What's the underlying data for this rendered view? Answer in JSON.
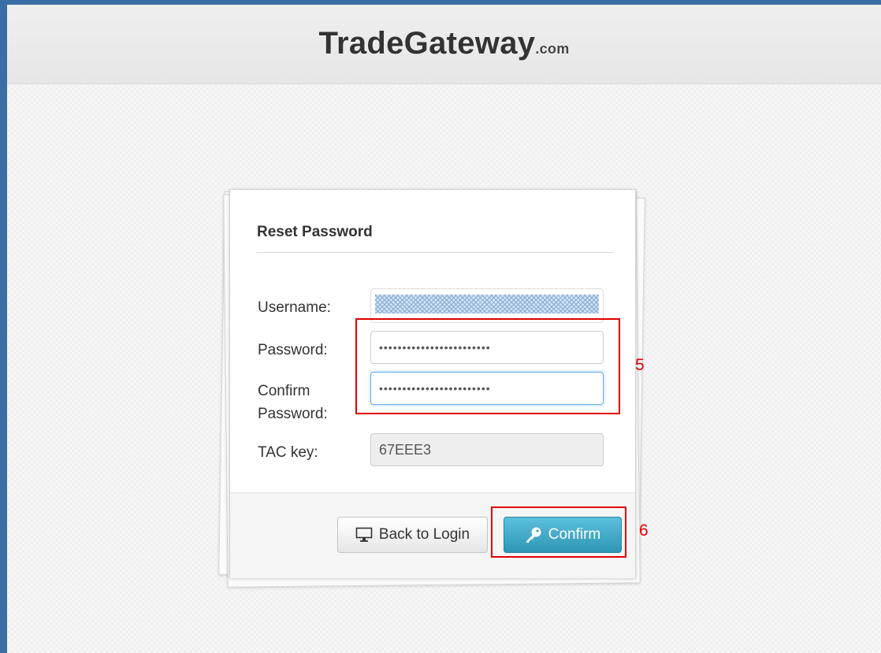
{
  "header": {
    "logo_main": "TradeGateway",
    "logo_tld": ".com"
  },
  "form": {
    "title": "Reset Password",
    "username_label": "Username:",
    "password_label": "Password:",
    "password_value": "••••••••••••••••••••••••",
    "confirm_label_line1": "Confirm",
    "confirm_label_line2": "Password:",
    "confirm_value": "••••••••••••••••••••••••",
    "tac_label": "TAC key:",
    "tac_value": "67EEE3"
  },
  "buttons": {
    "back_label": "Back to Login",
    "back_icon": "monitor-icon",
    "confirm_label": "Confirm",
    "confirm_icon": "key-icon"
  },
  "annotations": {
    "step_password": "5",
    "step_confirm": "6"
  },
  "colors": {
    "frame_border": "#3a6ea5",
    "confirm_button": "#2f96b4",
    "annotation": "#e00000"
  }
}
